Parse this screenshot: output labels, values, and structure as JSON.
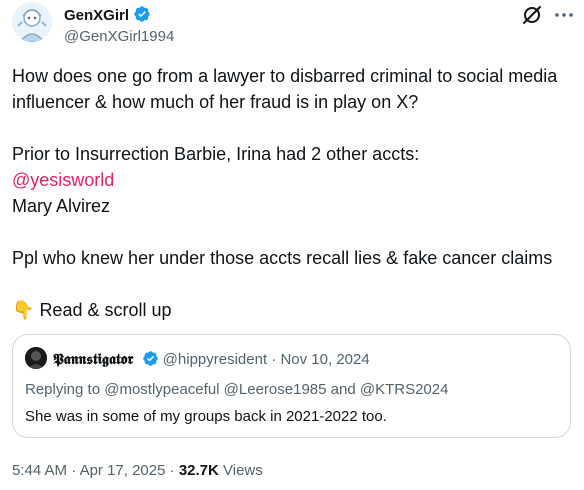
{
  "author": {
    "display_name": "GenXGirl",
    "handle": "@GenXGirl1994",
    "verified": true
  },
  "tweet": {
    "line1": "How does one go from a lawyer to disbarred criminal to social media influencer & how much of her fraud is in play on X?",
    "line2": "Prior to Insurrection Barbie, Irina had 2 other accts:",
    "mention": "@yesisworld",
    "line3": "Mary Alvirez",
    "line4": "Ppl who knew her under those accts recall lies & fake cancer claims",
    "emoji": "👇",
    "line5": "Read & scroll up"
  },
  "quote": {
    "display_name": "𝕻𝖆𝖓𝖓𝖘𝖙𝖎𝖌𝖆𝖙𝖔𝖗",
    "handle": "@hippyresident",
    "separator": "·",
    "date": "Nov 10, 2024",
    "replying_prefix": "Replying to",
    "reply_to_1": "@mostlypeaceful",
    "reply_to_2": "@Leerose1985",
    "reply_and": "and",
    "reply_to_3": "@KTRS2024",
    "body": "She was in some of my groups back in 2021-2022 too."
  },
  "footer": {
    "time": "5:44 AM",
    "separator": "·",
    "date": "Apr 17, 2025",
    "separator2": "·",
    "views_count": "32.7K",
    "views_label": "Views"
  },
  "colors": {
    "accent_blue": "#1d9bf0",
    "mention_pink": "#e0245e",
    "secondary_text": "#536471",
    "border": "#cfd9de"
  }
}
